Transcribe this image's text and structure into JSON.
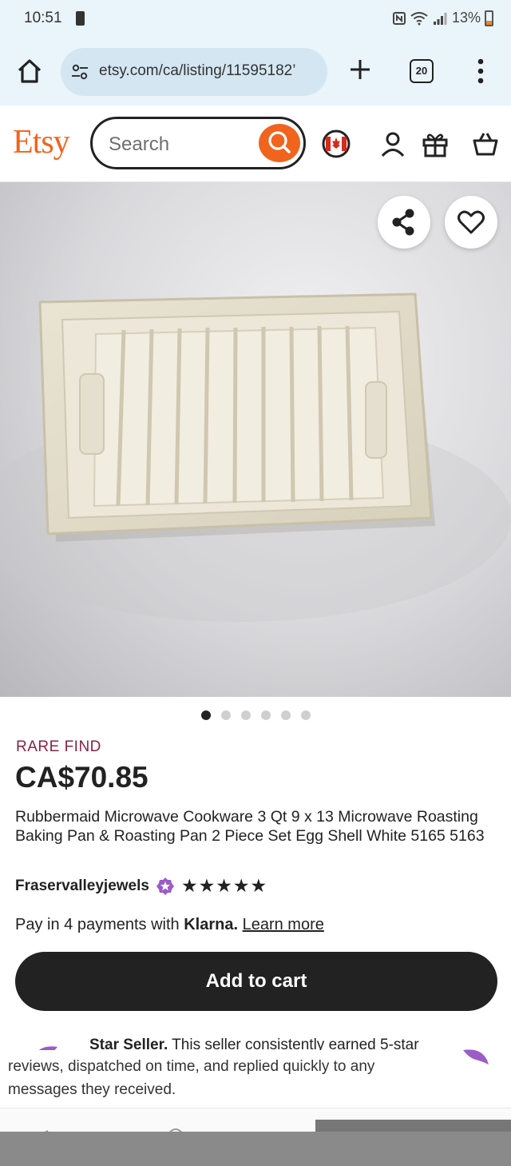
{
  "status_bar": {
    "time": "10:51",
    "battery": "13%"
  },
  "browser": {
    "url": "etsy.com/ca/listing/11595182’",
    "tab_count": "20"
  },
  "header": {
    "logo": "Etsy",
    "search_placeholder": "Search"
  },
  "listing": {
    "badge": "RARE FIND",
    "price": "CA$70.85",
    "title": "Rubbermaid Microwave Cookware 3 Qt 9 x 13 Microwave Roasting Baking Pan & Roasting Pan 2 Piece Set Egg Shell White 5165 5163",
    "seller": "Fraservalleyjewels",
    "stars": "★★★★★",
    "rating": 5,
    "image_index": 1,
    "image_count": 6
  },
  "klarna": {
    "prefix": "Pay in 4 payments with ",
    "brand": "Klarna.",
    "learn_more": "Learn more"
  },
  "cart": {
    "add_label": "Add to cart"
  },
  "star_seller": {
    "title": "Star Seller.",
    "line1_rest": " This seller consistently earned 5-star",
    "text": "reviews, dispatched on time, and replied quickly to any messages they received."
  },
  "colors": {
    "accent": "#f1641e",
    "rare": "#8a2245",
    "cart": "#222222",
    "badge": "#9b5cc7"
  }
}
